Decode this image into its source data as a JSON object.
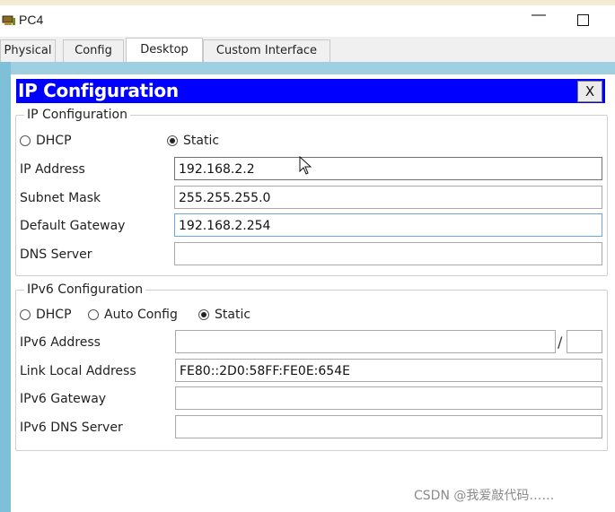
{
  "window": {
    "title": "PC4",
    "minimize_glyph": "—"
  },
  "tabs": [
    {
      "label": "Physical"
    },
    {
      "label": "Config"
    },
    {
      "label": "Desktop"
    },
    {
      "label": "Custom Interface"
    }
  ],
  "dialog": {
    "title": "IP Configuration",
    "close_label": "X"
  },
  "ipv4": {
    "legend": "IP Configuration",
    "dhcp_label": "DHCP",
    "static_label": "Static",
    "selected": "Static",
    "ip_address_label": "IP Address",
    "ip_address_value": "192.168.2.2",
    "subnet_mask_label": "Subnet Mask",
    "subnet_mask_value": "255.255.255.0",
    "default_gateway_label": "Default Gateway",
    "default_gateway_value": "192.168.2.254",
    "dns_server_label": "DNS Server",
    "dns_server_value": ""
  },
  "ipv6": {
    "legend": "IPv6 Configuration",
    "dhcp_label": "DHCP",
    "auto_config_label": "Auto Config",
    "static_label": "Static",
    "selected": "Static",
    "address_label": "IPv6 Address",
    "address_value": "",
    "prefix_separator": "/",
    "prefix_value": "",
    "link_local_label": "Link Local Address",
    "link_local_value": "FE80::2D0:58FF:FE0E:654E",
    "gateway_label": "IPv6 Gateway",
    "gateway_value": "",
    "dns_label": "IPv6 DNS Server",
    "dns_value": ""
  },
  "watermark": "CSDN @我爱敲代码……",
  "colors": {
    "dialog_header": "#0000ff",
    "frame_border": "#7ec0d8"
  }
}
